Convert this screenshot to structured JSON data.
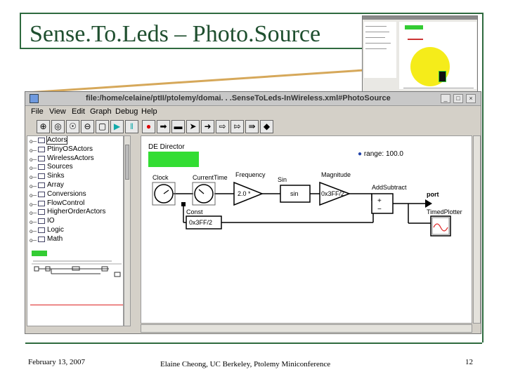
{
  "slide": {
    "title": "Sense.To.Leds – Photo.Source",
    "footer_date": "February 13, 2007",
    "footer_author": "Elaine Cheong, UC Berkeley, Ptolemy Miniconference",
    "page_number": "12"
  },
  "window": {
    "title": "file:/home/celaine/ptII/ptolemy/domai. . .SenseToLeds-InWireless.xml#PhotoSource",
    "min_label": "_",
    "max_label": "□",
    "close_label": "×"
  },
  "menu": [
    "File",
    "View",
    "Edit",
    "Graph",
    "Debug",
    "Help"
  ],
  "toolbar_icons": [
    "zoom-in-icon",
    "zoom-reset-icon",
    "zoom-fit-icon",
    "zoom-out-icon",
    "fit-to-window-icon",
    "run-icon",
    "pause-icon",
    "stop-icon",
    "arrow-icon",
    "arrow-right-icon",
    "arrow-next-icon",
    "arrow-forward-icon",
    "hollow-arrow-icon",
    "hollow-arrow-2-icon",
    "hollow-arrow-3-icon",
    "diamond-icon"
  ],
  "library": {
    "items": [
      "Actors",
      "PtinyOSActors",
      "WirelessActors",
      "Sources",
      "Sinks",
      "Array",
      "Conversions",
      "FlowControl",
      "HigherOrderActors",
      "IO",
      "Logic",
      "Math"
    ]
  },
  "model": {
    "director_label": "DE Director",
    "range_label": "range: 100.0",
    "actors": {
      "clock": "Clock",
      "current_time": "CurrentTime",
      "frequency": "Frequency",
      "frequency_value": "2.0 *",
      "sin": "Sin",
      "sin_box": "sin",
      "magnitude": "Magnitude",
      "magnitude_value": "0x3FF/2",
      "add_subtract": "AddSubtract",
      "port": "port",
      "const": "Const",
      "const_value": "0x3FF/2",
      "timed_plotter": "TimedPlotter"
    }
  },
  "colors": {
    "title_color": "#1f4f2f",
    "director_green": "#33dd33",
    "stop_red": "#dd0000",
    "run_teal": "#11aaaa",
    "sun_yellow": "#f5ec1a",
    "connector": "#d6a85a"
  }
}
